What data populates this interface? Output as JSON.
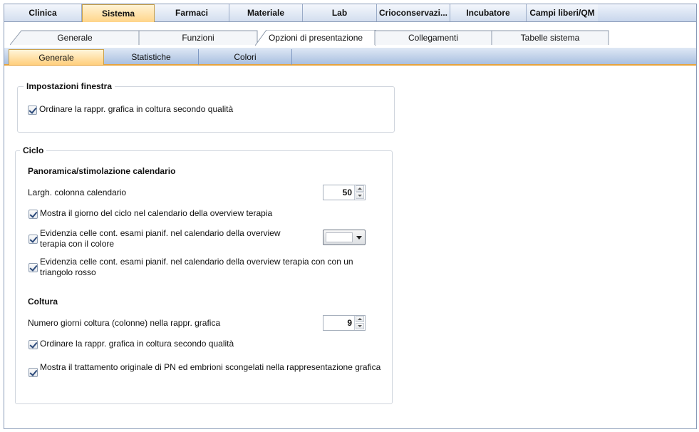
{
  "top_tabs": [
    {
      "label": "Clinica"
    },
    {
      "label": "Sistema",
      "active": true
    },
    {
      "label": "Farmaci"
    },
    {
      "label": "Materiale"
    },
    {
      "label": "Lab"
    },
    {
      "label": "Crioconservazi..."
    },
    {
      "label": "Incubatore"
    },
    {
      "label": "Campi liberi/QM"
    }
  ],
  "sub_tabs": [
    {
      "label": "Generale"
    },
    {
      "label": "Funzioni"
    },
    {
      "label": "Opzioni di presentazione",
      "active": true
    },
    {
      "label": "Collegamenti"
    },
    {
      "label": "Tabelle sistema"
    }
  ],
  "third_tabs": [
    {
      "label": "Generale",
      "active": true
    },
    {
      "label": "Statistiche"
    },
    {
      "label": "Colori"
    }
  ],
  "window_settings": {
    "title": "Impostazioni finestra",
    "sort_by_quality": {
      "label": "Ordinare la rappr. grafica in coltura secondo qualità",
      "checked": true
    }
  },
  "cycle": {
    "title": "Ciclo",
    "calendar_heading": "Panoramica/stimolazione calendario",
    "column_width": {
      "label": "Largh. colonna calendario",
      "value": "50"
    },
    "show_cycle_day": {
      "label": "Mostra il giorno del ciclo nel calendario della overview terapia",
      "checked": true
    },
    "highlight_color": {
      "line1": "Evidenzia celle cont. esami pianif. nel calendario della overview",
      "line2": "terapia con il colore",
      "checked": true,
      "color": "#ffffff"
    },
    "highlight_triangle": {
      "line1": "Evidenzia celle cont. esami pianif. nel calendario della overview terapia con con un",
      "line2": "triangolo rosso",
      "checked": true
    },
    "culture_heading": "Coltura",
    "culture_days": {
      "label": "Numero giorni coltura (colonne) nella rappr. grafica",
      "value": "9"
    },
    "culture_sort_by_quality": {
      "label": "Ordinare la rappr. grafica in coltura secondo qualità",
      "checked": true
    },
    "show_original_treatment": {
      "label": "Mostra il trattamento originale di PN ed embrioni scongelati nella rappresentazione grafica",
      "checked": true
    }
  },
  "colors": {
    "accent": "#e8a33b",
    "tab_blue": "#a9c0e0",
    "active_tab": "#ffd58a"
  }
}
